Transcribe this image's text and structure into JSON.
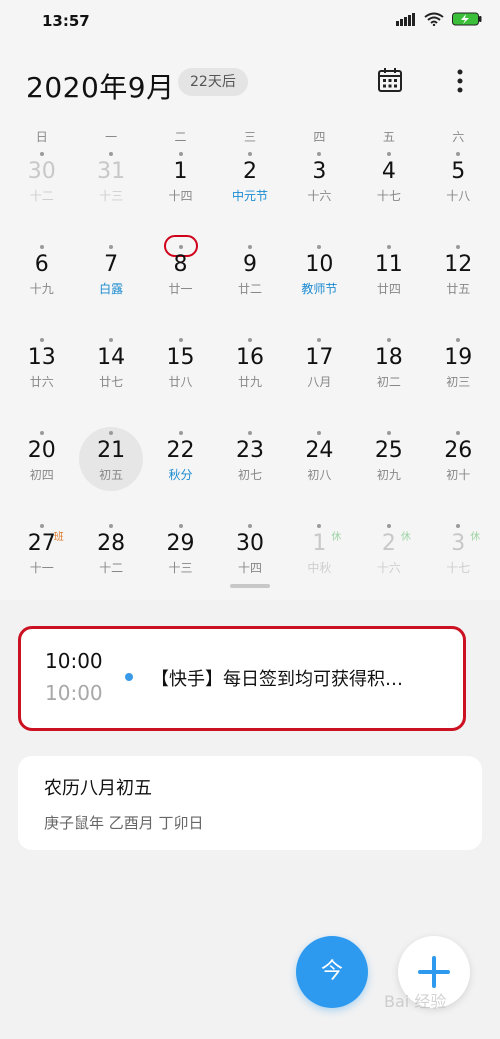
{
  "status": {
    "time": "13:57",
    "battery_color": "#3bbf3b"
  },
  "header": {
    "title": "2020年9月",
    "days_badge": "22天后",
    "calendar_icon": "calendar-icon",
    "more_icon": "more-vertical-icon"
  },
  "weekdays": [
    "日",
    "一",
    "二",
    "三",
    "四",
    "五",
    "六"
  ],
  "weeks": [
    [
      {
        "d": "30",
        "l": "十二",
        "other": true
      },
      {
        "d": "31",
        "l": "十三",
        "other": true
      },
      {
        "d": "1",
        "l": "十四"
      },
      {
        "d": "2",
        "l": "中元节",
        "fest": true
      },
      {
        "d": "3",
        "l": "十六"
      },
      {
        "d": "4",
        "l": "十七"
      },
      {
        "d": "5",
        "l": "十八"
      }
    ],
    [
      {
        "d": "6",
        "l": "十九"
      },
      {
        "d": "7",
        "l": "白露",
        "fest": true
      },
      {
        "d": "8",
        "l": "廿一",
        "mark": true
      },
      {
        "d": "9",
        "l": "廿二"
      },
      {
        "d": "10",
        "l": "教师节",
        "fest": true
      },
      {
        "d": "11",
        "l": "廿四"
      },
      {
        "d": "12",
        "l": "廿五"
      }
    ],
    [
      {
        "d": "13",
        "l": "廿六"
      },
      {
        "d": "14",
        "l": "廿七"
      },
      {
        "d": "15",
        "l": "廿八"
      },
      {
        "d": "16",
        "l": "廿九"
      },
      {
        "d": "17",
        "l": "八月"
      },
      {
        "d": "18",
        "l": "初二"
      },
      {
        "d": "19",
        "l": "初三"
      }
    ],
    [
      {
        "d": "20",
        "l": "初四"
      },
      {
        "d": "21",
        "l": "初五",
        "selected": true
      },
      {
        "d": "22",
        "l": "秋分",
        "fest": true
      },
      {
        "d": "23",
        "l": "初七"
      },
      {
        "d": "24",
        "l": "初八"
      },
      {
        "d": "25",
        "l": "初九"
      },
      {
        "d": "26",
        "l": "初十"
      }
    ],
    [
      {
        "d": "27",
        "l": "十一",
        "tag": "班",
        "tagType": "work"
      },
      {
        "d": "28",
        "l": "十二"
      },
      {
        "d": "29",
        "l": "十三"
      },
      {
        "d": "30",
        "l": "十四"
      },
      {
        "d": "1",
        "l": "中秋",
        "other": true,
        "fest": true,
        "tag": "休",
        "tagType": "rest"
      },
      {
        "d": "2",
        "l": "十六",
        "other": true,
        "tag": "休",
        "tagType": "rest"
      },
      {
        "d": "3",
        "l": "十七",
        "other": true,
        "tag": "休",
        "tagType": "rest"
      }
    ]
  ],
  "event": {
    "start": "10:00",
    "end": "10:00",
    "title": "【快手】每日签到均可获得积…",
    "dot_color": "#3b9ae8"
  },
  "lunar_card": {
    "date": "农历八月初五",
    "ganzhi": "庚子鼠年 乙酉月 丁卯日"
  },
  "fab": {
    "today_label": "今",
    "add_icon": "plus-icon"
  },
  "watermark": "Bai 经验",
  "colors": {
    "accent": "#2e9aef",
    "festival": "#1b8bd1",
    "highlight": "#cc1122"
  }
}
